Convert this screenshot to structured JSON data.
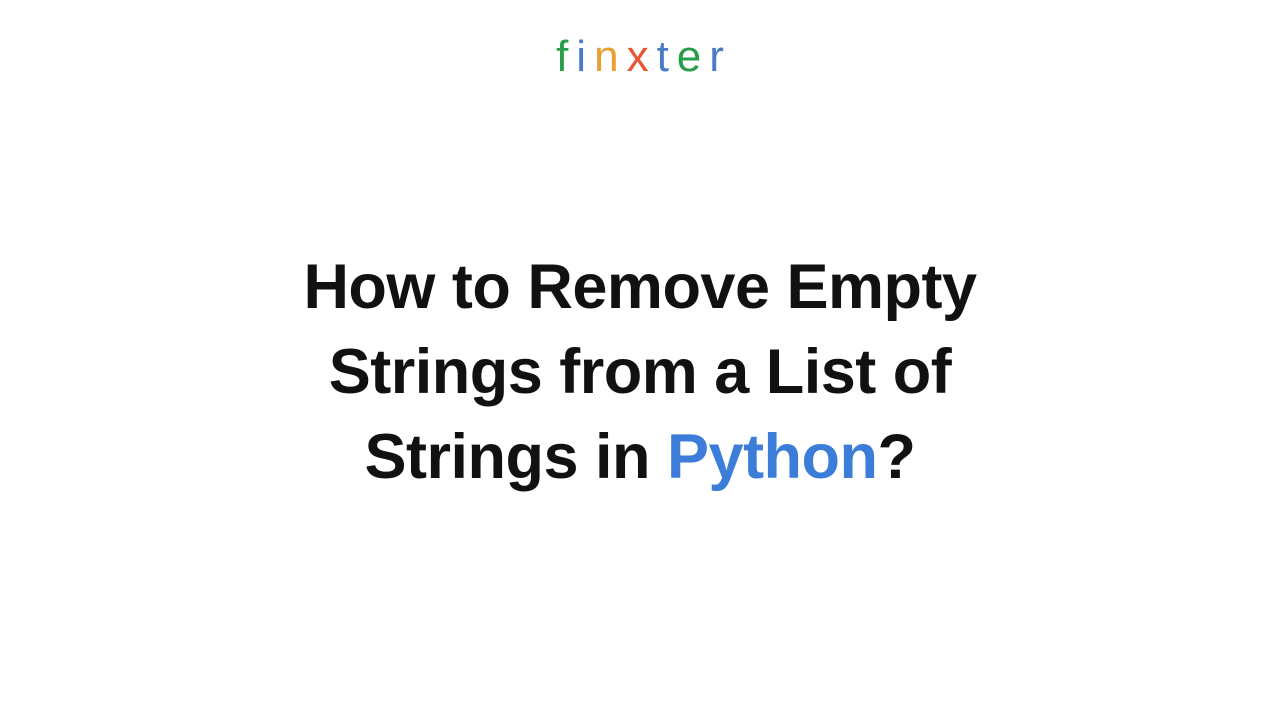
{
  "logo": {
    "letters": [
      {
        "char": "f",
        "color": "#2a9d4a"
      },
      {
        "char": "i",
        "color": "#4a7bc8"
      },
      {
        "char": "n",
        "color": "#e8a030"
      },
      {
        "char": "x",
        "color": "#e85530"
      },
      {
        "char": "t",
        "color": "#4a7bc8"
      },
      {
        "char": "e",
        "color": "#2a9d4a"
      },
      {
        "char": "r",
        "color": "#4a7bc8"
      }
    ]
  },
  "title": {
    "line1": "How to Remove Empty",
    "line2": "Strings from a List of",
    "line3_prefix": "Strings in ",
    "line3_highlight": "Python",
    "line3_suffix": "?"
  }
}
